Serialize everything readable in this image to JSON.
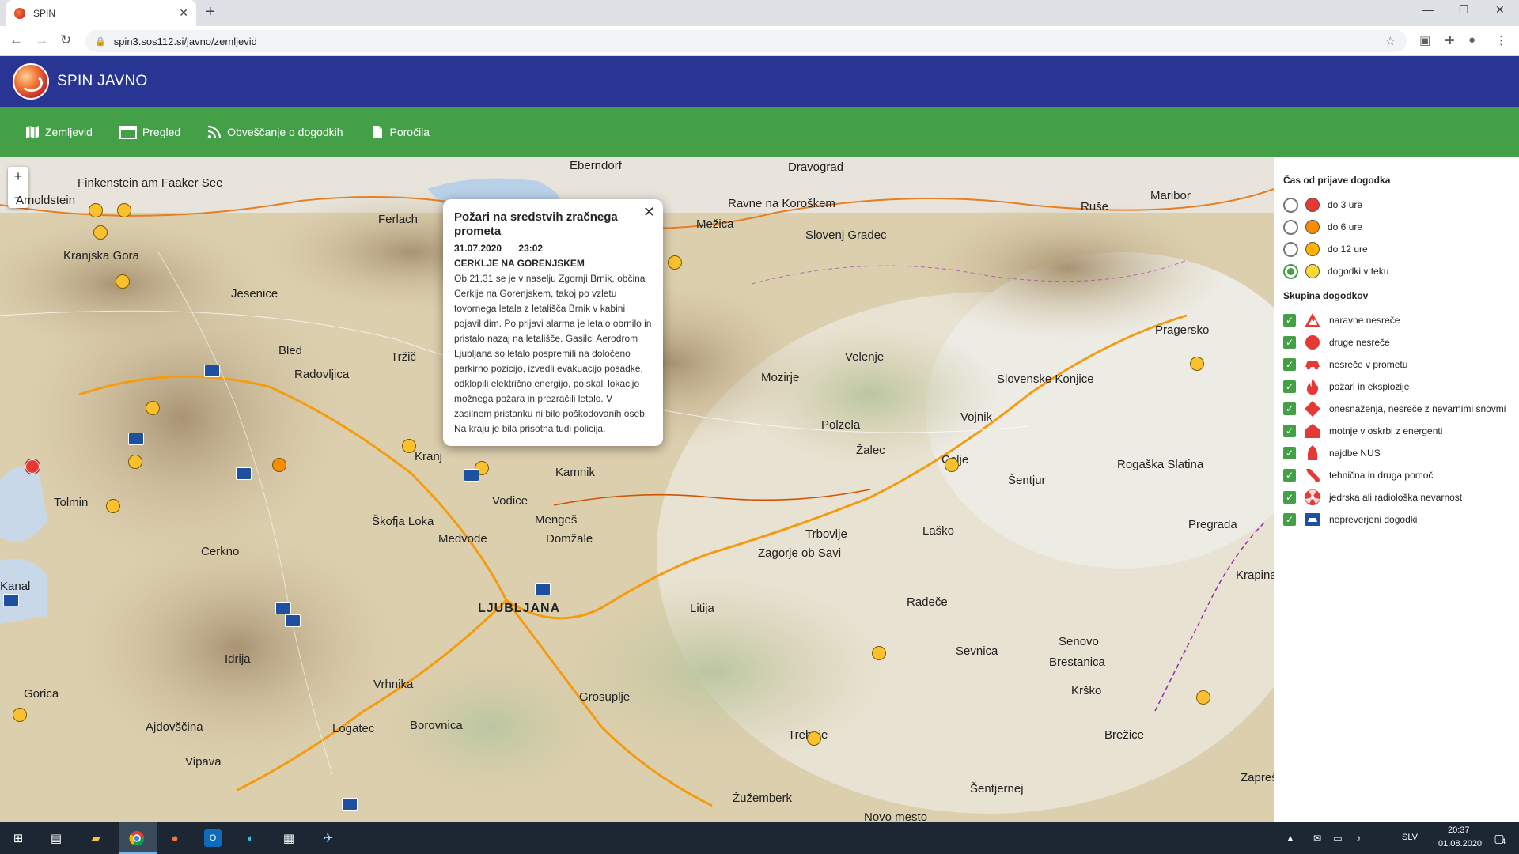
{
  "browser": {
    "tab_title": "SPIN",
    "url": "spin3.sos112.si/javno/zemljevid"
  },
  "header": {
    "app_title": "SPIN JAVNO"
  },
  "nav": {
    "items": [
      {
        "label": "Zemljevid",
        "icon": "map-icon"
      },
      {
        "label": "Pregled",
        "icon": "window-icon"
      },
      {
        "label": "Obveščanje o dogodkih",
        "icon": "rss-icon"
      },
      {
        "label": "Poročila",
        "icon": "document-icon"
      }
    ]
  },
  "map": {
    "zoom_in": "+",
    "zoom_out": "−",
    "labels": [
      {
        "text": "Finkenstein am Faaker See"
      },
      {
        "text": "Arnoldstein"
      },
      {
        "text": "Ferlach"
      },
      {
        "text": "Eberndorf"
      },
      {
        "text": "Dravograd"
      },
      {
        "text": "Ravne na Koroškem"
      },
      {
        "text": "Mežica"
      },
      {
        "text": "Slovenj Gradec"
      },
      {
        "text": "Ruše"
      },
      {
        "text": "Maribor"
      },
      {
        "text": "Kranjska Gora"
      },
      {
        "text": "Jesenice"
      },
      {
        "text": "Bled"
      },
      {
        "text": "Radovljica"
      },
      {
        "text": "Tržič"
      },
      {
        "text": "Kranj"
      },
      {
        "text": "Mozirje"
      },
      {
        "text": "Velenje"
      },
      {
        "text": "Slovenske Konjice"
      },
      {
        "text": "Pragersko"
      },
      {
        "text": "Polzela"
      },
      {
        "text": "Žalec"
      },
      {
        "text": "Vojnik"
      },
      {
        "text": "Celje"
      },
      {
        "text": "Šentjur"
      },
      {
        "text": "Rogaška Slatina"
      },
      {
        "text": "Tolmin"
      },
      {
        "text": "Škofja Loka"
      },
      {
        "text": "Vodice"
      },
      {
        "text": "Kamnik"
      },
      {
        "text": "Mengeš"
      },
      {
        "text": "Domžale"
      },
      {
        "text": "Medvode"
      },
      {
        "text": "LJUBLJANA"
      },
      {
        "text": "Litija"
      },
      {
        "text": "Trbovlje"
      },
      {
        "text": "Zagorje ob Savi"
      },
      {
        "text": "Laško"
      },
      {
        "text": "Radeče"
      },
      {
        "text": "Cerkno"
      },
      {
        "text": "Kanal"
      },
      {
        "text": "Idrija"
      },
      {
        "text": "Vrhnika"
      },
      {
        "text": "Grosuplje"
      },
      {
        "text": "Sevnica"
      },
      {
        "text": "Senovo"
      },
      {
        "text": "Brestanica"
      },
      {
        "text": "Krško"
      },
      {
        "text": "Brežice"
      },
      {
        "text": "Pregrada"
      },
      {
        "text": "Krapina"
      },
      {
        "text": "Gorica"
      },
      {
        "text": "Ajdovščina"
      },
      {
        "text": "Logatec"
      },
      {
        "text": "Borovnica"
      },
      {
        "text": "Vipava"
      },
      {
        "text": "Trebnje"
      },
      {
        "text": "Žužemberk"
      },
      {
        "text": "Šentjernej"
      },
      {
        "text": "Novo mesto"
      },
      {
        "text": "Zaprešić"
      }
    ]
  },
  "popup": {
    "title": "Požari na sredstvih zračnega prometa",
    "date": "31.07.2020",
    "time": "23:02",
    "location": "CERKLJE NA GORENJSKEM",
    "body": "Ob 21.31 se je v naselju Zgornji Brnik, občina Cerklje na Gorenjskem, takoj po vzletu tovornega letala z letališča Brnik v kabini pojavil dim. Po prijavi alarma je letalo obrnilo in pristalo nazaj na letališče. Gasilci Aerodrom Ljubljana so letalo pospremili na določeno parkirno pozicijo, izvedli evakuacijo posadke, odklopili električno energijo, poiskali lokacijo možnega požara in prezračili letalo. V zasilnem pristanku ni bilo poškodovanih oseb. Na kraju je bila prisotna tudi policija."
  },
  "legend": {
    "time_heading": "Čas od prijave dogodka",
    "time_options": [
      {
        "label": "do 3 ure",
        "color": "#e53935",
        "checked": false
      },
      {
        "label": "do 6 ure",
        "color": "#fb8c00",
        "checked": false
      },
      {
        "label": "do 12 ure",
        "color": "#ffb300",
        "checked": false
      },
      {
        "label": "dogodki v teku",
        "color": "#fdd835",
        "checked": true
      }
    ],
    "group_heading": "Skupina dogodkov",
    "groups": [
      {
        "label": "naravne nesreče",
        "icon": "natural-disaster-icon"
      },
      {
        "label": "druge nesreče",
        "icon": "other-accident-icon"
      },
      {
        "label": "nesreče v prometu",
        "icon": "traffic-accident-icon"
      },
      {
        "label": "požari in eksplozije",
        "icon": "fire-icon"
      },
      {
        "label": "onesnaženja, nesreče z nevarnimi snovmi",
        "icon": "hazmat-icon"
      },
      {
        "label": "motnje v oskrbi z energenti",
        "icon": "energy-outage-icon"
      },
      {
        "label": "najdbe NUS",
        "icon": "ordnance-icon"
      },
      {
        "label": "tehnična in druga pomoč",
        "icon": "technical-help-icon"
      },
      {
        "label": "jedrska ali radiološka nevarnost",
        "icon": "radiation-icon"
      },
      {
        "label": "nepreverjeni dogodki",
        "icon": "unverified-icon"
      }
    ]
  },
  "taskbar": {
    "lang": "SLV",
    "time": "20:37",
    "date": "01.08.2020",
    "notifications": "4"
  }
}
